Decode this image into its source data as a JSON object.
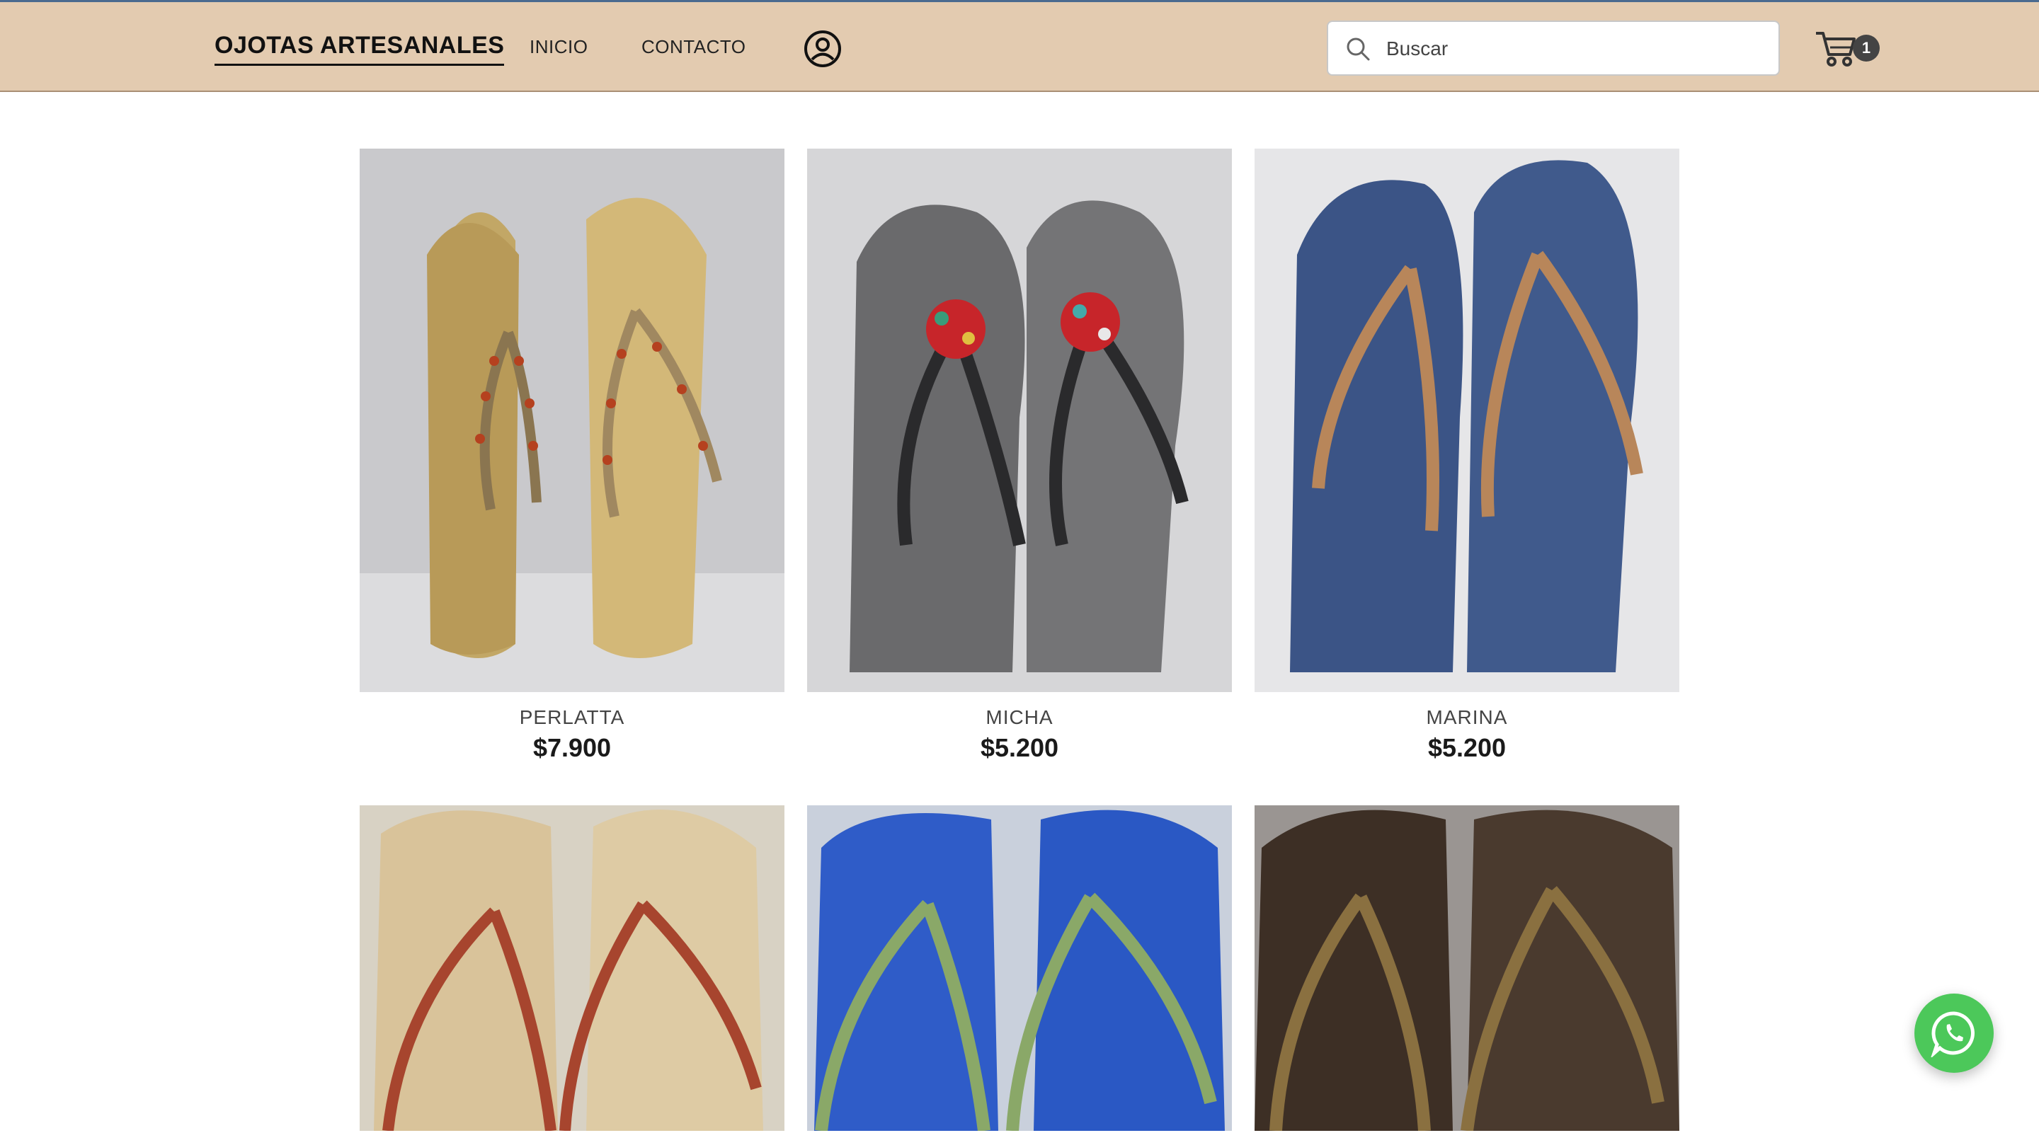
{
  "header": {
    "brand": "OJOTAS ARTESANALES",
    "nav": [
      {
        "label": "INICIO"
      },
      {
        "label": "CONTACTO"
      }
    ],
    "account_icon": "user-circle-icon",
    "search": {
      "placeholder": "Buscar",
      "value": "",
      "icon": "search-icon"
    },
    "cart": {
      "icon": "cart-icon",
      "count": "1"
    }
  },
  "colors": {
    "header_bg": "#e3cbb0",
    "whatsapp": "#4cc85a"
  },
  "products": [
    {
      "name": "PERLATTA",
      "price": "$7.900",
      "image": "product-photo"
    },
    {
      "name": "MICHA",
      "price": "$5.200",
      "image": "product-photo"
    },
    {
      "name": "MARINA",
      "price": "$5.200",
      "image": "product-photo"
    },
    {
      "name": "",
      "price": "",
      "image": "product-photo"
    },
    {
      "name": "",
      "price": "",
      "image": "product-photo"
    },
    {
      "name": "",
      "price": "",
      "image": "product-photo"
    }
  ],
  "floating": {
    "whatsapp_icon": "whatsapp-icon"
  }
}
